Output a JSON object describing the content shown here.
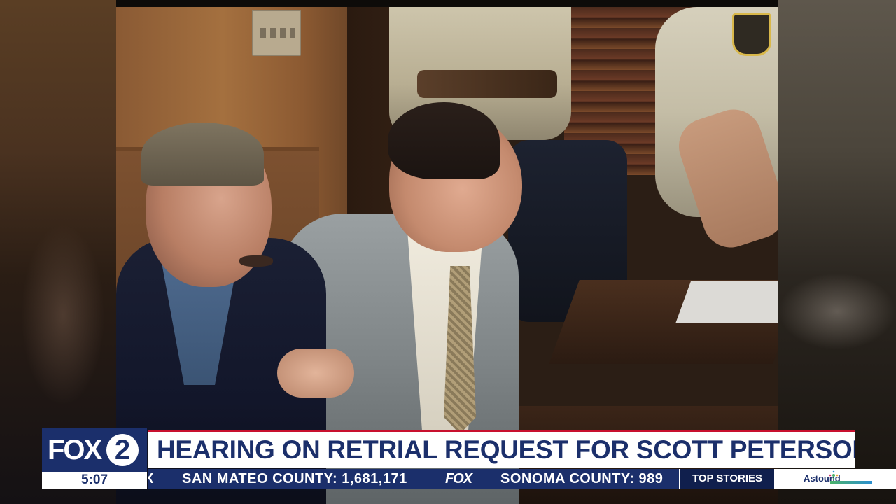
{
  "lower_third": {
    "station_logo_text": "FOX",
    "station_logo_number": "2",
    "time": "5:07",
    "headline": "HEARING ON RETRIAL REQUEST FOR SCOTT PETERSON"
  },
  "ticker": {
    "lead_fragment": "X",
    "items": [
      "SAN MATEO COUNTY: 1,681,171",
      "SONOMA COUNTY: 989"
    ],
    "separator_logo": "FOX",
    "section_label": "TOP STORIES"
  },
  "sponsor": {
    "name": "Astound"
  },
  "colors": {
    "brand_navy": "#1b2f6b",
    "headline_accent_red": "#c8102e",
    "white": "#ffffff"
  },
  "icons": {
    "sponsor_logo": "sparkle-icon"
  }
}
